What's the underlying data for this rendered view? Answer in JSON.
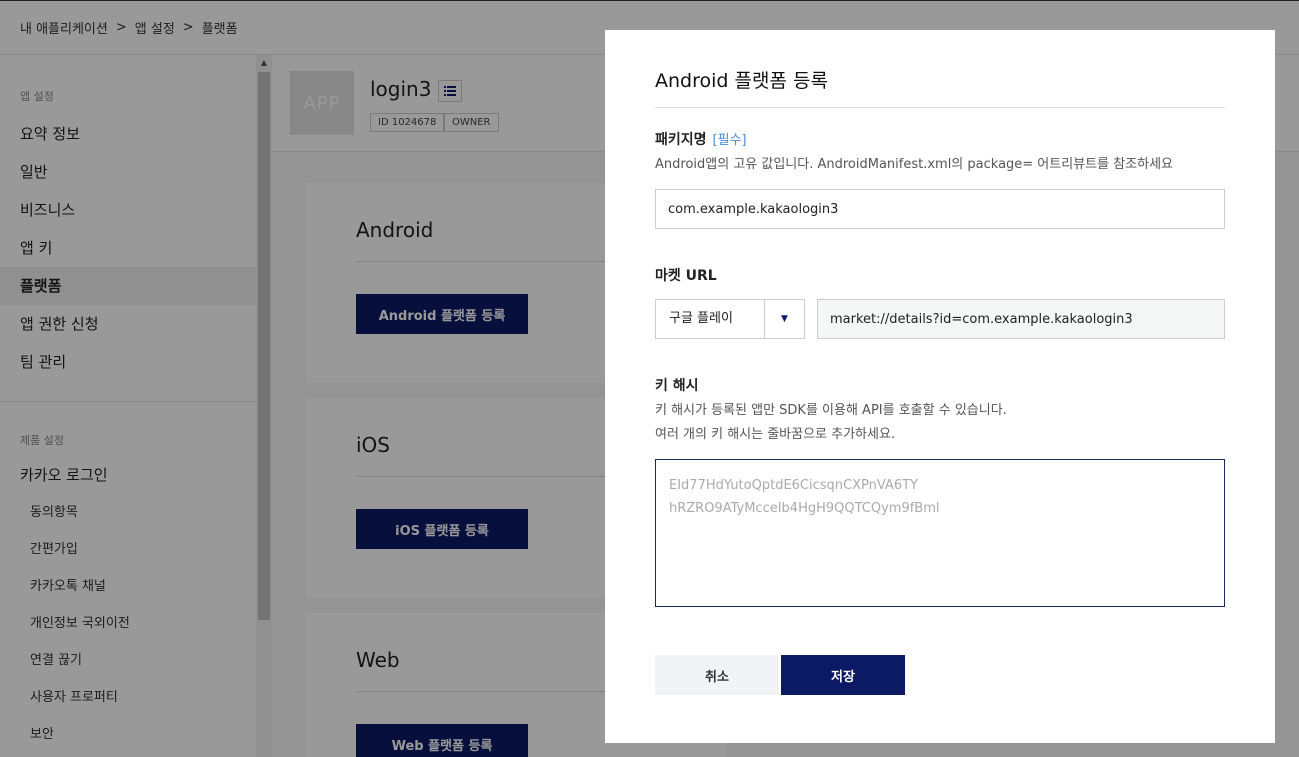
{
  "breadcrumb": {
    "items": [
      "내 애플리케이션",
      "앱 설정",
      "플랫폼"
    ],
    "separator": ">"
  },
  "sidebar": {
    "app_group_title": "앱 설정",
    "app_items": [
      "요약 정보",
      "일반",
      "비즈니스",
      "앱 키",
      "플랫폼",
      "앱 권한 신청",
      "팀 관리"
    ],
    "active_item": "플랫폼",
    "product_group_title": "제품 설정",
    "product_item": "카카오 로그인",
    "product_subitems": [
      "동의항목",
      "간편가입",
      "카카오톡 채널",
      "개인정보 국외이전",
      "연결 끊기",
      "사용자 프로퍼티",
      "보안"
    ]
  },
  "app": {
    "icon_text": "APP",
    "name": "login3",
    "id_badge": "ID 1024678",
    "role_badge": "OWNER"
  },
  "platforms": [
    {
      "title": "Android",
      "button": "Android 플랫폼 등록"
    },
    {
      "title": "iOS",
      "button": "iOS 플랫폼 등록"
    },
    {
      "title": "Web",
      "button": "Web 플랫폼 등록"
    }
  ],
  "modal": {
    "title": "Android 플랫폼 등록",
    "package": {
      "label": "패키지명",
      "required": "[필수]",
      "desc": "Android앱의 고유 값입니다. AndroidManifest.xml의 package= 어트리뷰트를 참조하세요",
      "value": "com.example.kakaologin3"
    },
    "market": {
      "label": "마켓 URL",
      "store": "구글 플레이",
      "url": "market://details?id=com.example.kakaologin3"
    },
    "keyhash": {
      "label": "키 해시",
      "desc1": "키 해시가 등록된 앱만 SDK를 이용해 API를 호출할 수 있습니다.",
      "desc2": "여러 개의 키 해시는 줄바꿈으로 추가하세요.",
      "placeholder": "EId77HdYutoQptdE6CicsqnCXPnVA6TY\nhRZRO9ATyMcceIb4HgH9QQTCQym9fBml"
    },
    "cancel": "취소",
    "save": "저장"
  },
  "colors": {
    "primary": "#0c1a66",
    "required": "#4a8bd6"
  }
}
